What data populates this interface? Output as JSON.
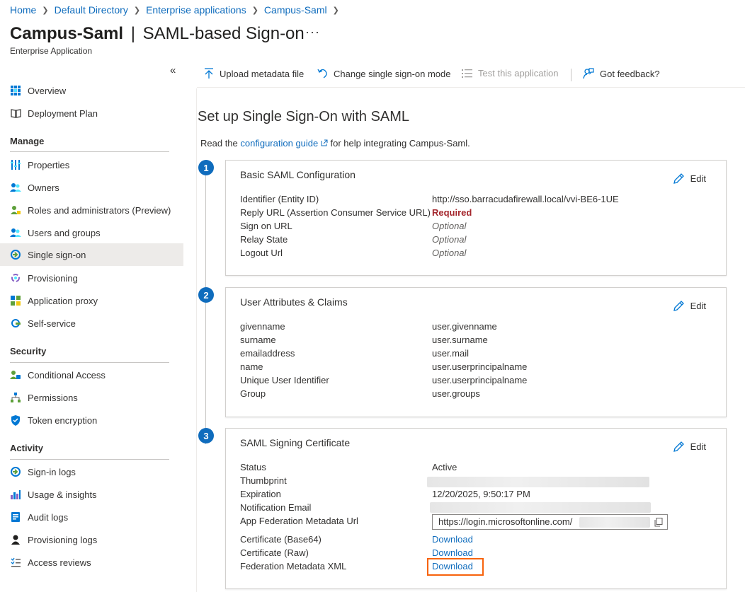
{
  "breadcrumb": [
    "Home",
    "Default Directory",
    "Enterprise applications",
    "Campus-Saml"
  ],
  "header": {
    "app_name": "Campus-Saml",
    "separator": "|",
    "page_name": "SAML-based Sign-on",
    "more": "···",
    "subtitle": "Enterprise Application"
  },
  "sidebar": {
    "collapse": "«",
    "top_items": [
      {
        "label": "Overview",
        "icon": "overview-icon"
      },
      {
        "label": "Deployment Plan",
        "icon": "book-icon"
      }
    ],
    "manage_title": "Manage",
    "manage_items": [
      {
        "label": "Properties",
        "icon": "properties-icon"
      },
      {
        "label": "Owners",
        "icon": "users-icon"
      },
      {
        "label": "Roles and administrators (Preview)",
        "icon": "roles-icon"
      },
      {
        "label": "Users and groups",
        "icon": "users-icon"
      },
      {
        "label": "Single sign-on",
        "icon": "sso-icon",
        "active": true
      },
      {
        "label": "Provisioning",
        "icon": "provisioning-icon"
      },
      {
        "label": "Application proxy",
        "icon": "app-proxy-icon"
      },
      {
        "label": "Self-service",
        "icon": "self-service-icon"
      }
    ],
    "security_title": "Security",
    "security_items": [
      {
        "label": "Conditional Access",
        "icon": "conditional-access-icon"
      },
      {
        "label": "Permissions",
        "icon": "permissions-icon"
      },
      {
        "label": "Token encryption",
        "icon": "shield-icon"
      }
    ],
    "activity_title": "Activity",
    "activity_items": [
      {
        "label": "Sign-in logs",
        "icon": "sign-in-icon"
      },
      {
        "label": "Usage & insights",
        "icon": "chart-icon"
      },
      {
        "label": "Audit logs",
        "icon": "audit-icon"
      },
      {
        "label": "Provisioning logs",
        "icon": "person-icon"
      },
      {
        "label": "Access reviews",
        "icon": "list-icon"
      }
    ]
  },
  "toolbar": {
    "upload": "Upload metadata file",
    "change_mode": "Change single sign-on mode",
    "test": "Test this application",
    "feedback": "Got feedback?"
  },
  "main": {
    "heading": "Set up Single Sign-On with SAML",
    "intro_prefix": "Read the",
    "intro_link": "configuration guide",
    "intro_suffix": "for help integrating Campus-Saml."
  },
  "cards": [
    {
      "step": "1",
      "title": "Basic SAML Configuration",
      "edit": "Edit",
      "rows": [
        {
          "k": "Identifier (Entity ID)",
          "v": "http://sso.barracudafirewall.local/vvi-BE6-1UE"
        },
        {
          "k": "Reply URL (Assertion Consumer Service URL)",
          "v": "Required"
        },
        {
          "k": "Sign on URL",
          "v": "Optional"
        },
        {
          "k": "Relay State",
          "v": "Optional"
        },
        {
          "k": "Logout Url",
          "v": "Optional"
        }
      ]
    },
    {
      "step": "2",
      "title": "User Attributes & Claims",
      "edit": "Edit",
      "rows": [
        {
          "k": "givenname",
          "v": "user.givenname"
        },
        {
          "k": "surname",
          "v": "user.surname"
        },
        {
          "k": "emailaddress",
          "v": "user.mail"
        },
        {
          "k": "name",
          "v": "user.userprincipalname"
        },
        {
          "k": "Unique User Identifier",
          "v": "user.userprincipalname"
        },
        {
          "k": "Group",
          "v": "user.groups"
        }
      ]
    },
    {
      "step": "3",
      "title": "SAML Signing Certificate",
      "edit": "Edit",
      "rows": [
        {
          "k": "Status",
          "v": "Active"
        },
        {
          "k": "Thumbprint",
          "v": ""
        },
        {
          "k": "Expiration",
          "v": "12/20/2025, 9:50:17 PM"
        },
        {
          "k": "Notification Email",
          "v": ""
        },
        {
          "k": "App Federation Metadata Url",
          "v": "https://login.microsoftonline.com/"
        },
        {
          "k": "Certificate (Base64)",
          "v": "Download"
        },
        {
          "k": "Certificate (Raw)",
          "v": "Download"
        },
        {
          "k": "Federation Metadata XML",
          "v": "Download"
        }
      ]
    }
  ],
  "colors": {
    "accent": "#0f6cbd",
    "required": "#a4262c",
    "highlight": "#f7630c",
    "active_nav": "#edebe9"
  }
}
